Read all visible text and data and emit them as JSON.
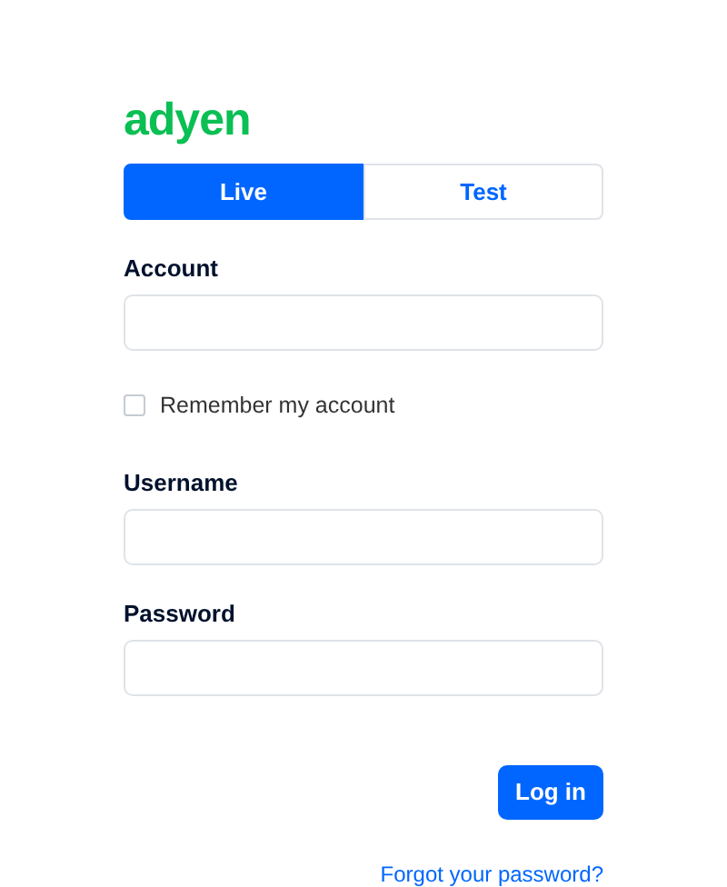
{
  "logo": "adyen",
  "tabs": [
    {
      "label": "Live",
      "selected": true
    },
    {
      "label": "Test",
      "selected": false
    }
  ],
  "fields": [
    {
      "kind": "input",
      "label": "Account"
    },
    {
      "kind": "checkbox",
      "label": "Remember my account",
      "checked": false
    },
    {
      "kind": "input",
      "label": "Username"
    },
    {
      "kind": "password",
      "label": "Password"
    }
  ],
  "login_button": "Log in",
  "forgot_link": "Forgot your password?"
}
